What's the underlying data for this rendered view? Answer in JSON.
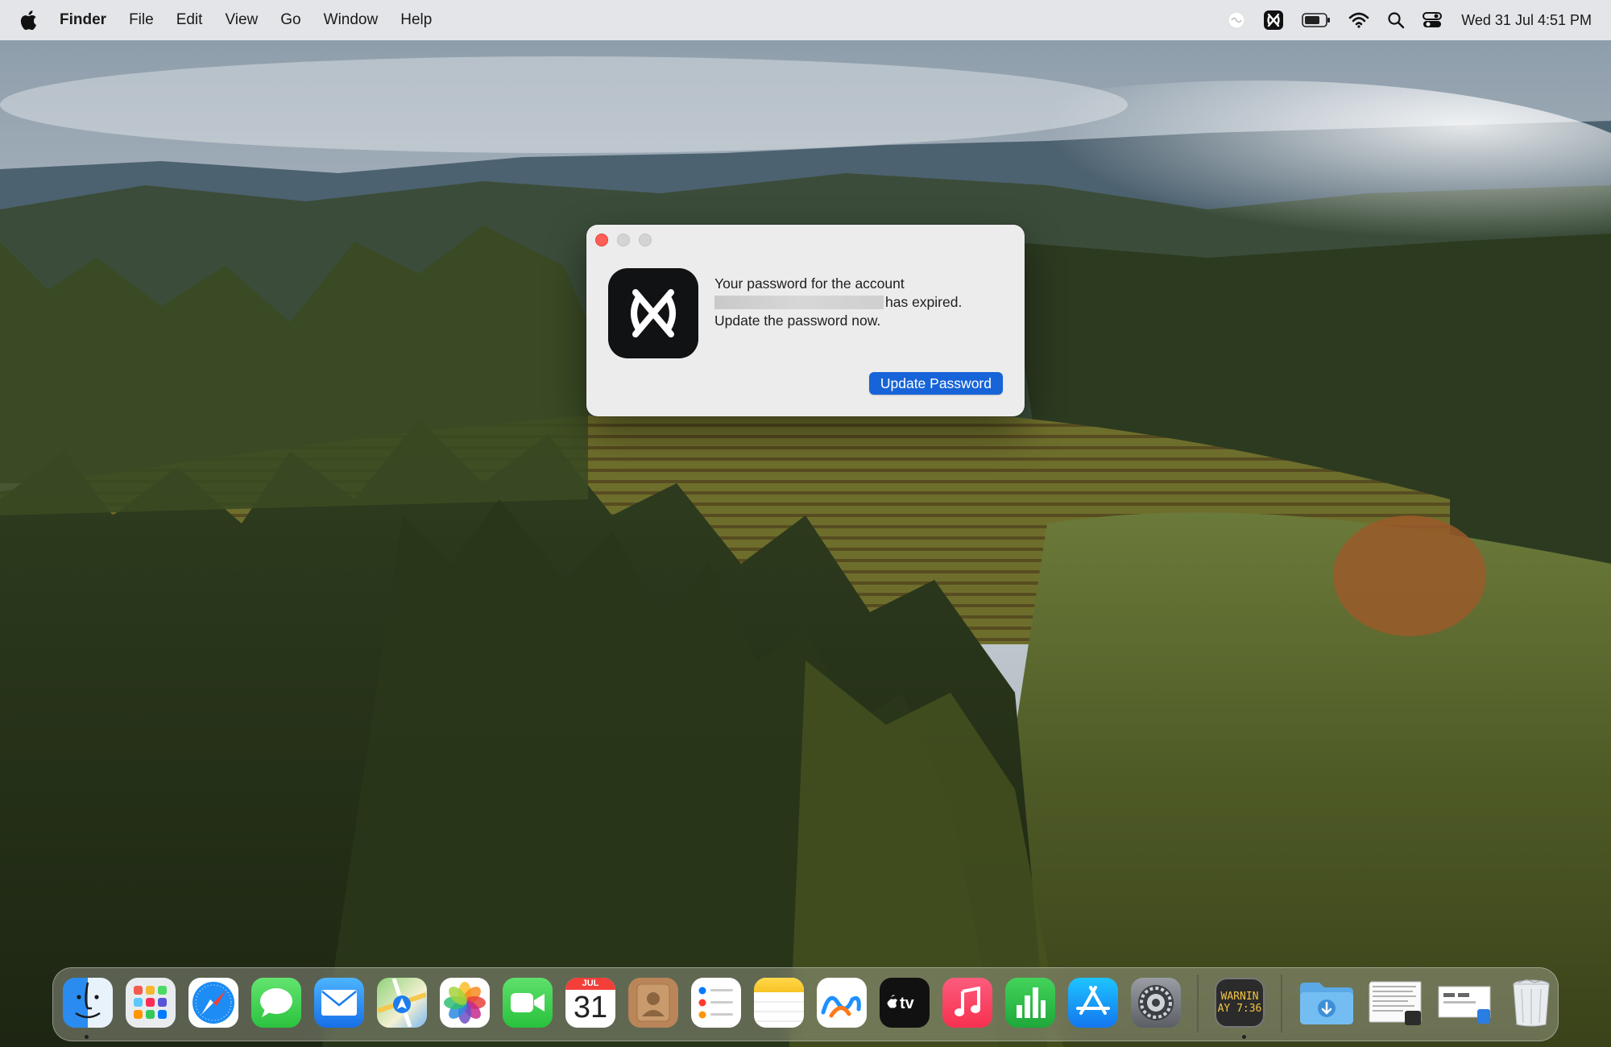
{
  "menubar": {
    "app_name": "Finder",
    "menus": [
      "File",
      "Edit",
      "View",
      "Go",
      "Window",
      "Help"
    ],
    "clock": "Wed 31 Jul  4:51 PM",
    "status_icons": [
      "siri-icon",
      "app-status-icon",
      "battery-icon",
      "wifi-icon",
      "spotlight-search-icon",
      "control-center-icon"
    ]
  },
  "dialog": {
    "message_line1": "Your password for the account",
    "message_line2_suffix": "has expired.",
    "message_line3": "Update the password now.",
    "primary_button": "Update Password"
  },
  "dock": {
    "calendar_month": "JUL",
    "calendar_day": "31",
    "console_text_1": "WARNIN",
    "console_text_2": "AY 7:36",
    "apps": [
      "Finder",
      "Launchpad",
      "Safari",
      "Messages",
      "Mail",
      "Maps",
      "Photos",
      "FaceTime",
      "Calendar",
      "Contacts",
      "Reminders",
      "Notes",
      "Freeform",
      "TV",
      "Music",
      "Numbers",
      "App Store",
      "System Settings",
      "Console",
      "Downloads",
      "Recent Document",
      "Recent Window",
      "Trash"
    ]
  },
  "colors": {
    "accent": "#1764d8",
    "close_button": "#ff5f57",
    "dialog_bg": "#ececec"
  }
}
